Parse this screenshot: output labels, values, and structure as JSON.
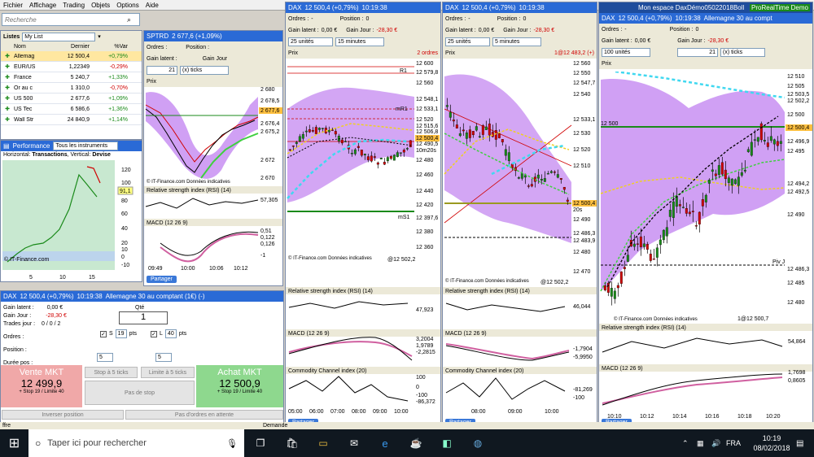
{
  "menu": [
    "Fichier",
    "Affichage",
    "Trading",
    "Objets",
    "Options",
    "Aide"
  ],
  "search": {
    "placeholder": "Recherche"
  },
  "lists": {
    "tab": "Listes",
    "selected": "My List",
    "cols": [
      "Nom",
      "Dernier",
      "%Var"
    ],
    "rows": [
      {
        "name": "Allemag",
        "price": "12 500,4",
        "var": "+0,79%",
        "pos": true
      },
      {
        "name": "EUR/US",
        "price": "1,22349",
        "var": "-0,29%",
        "pos": false
      },
      {
        "name": "France",
        "price": "5 240,7",
        "var": "+1,33%",
        "pos": true
      },
      {
        "name": "Or au c",
        "price": "1 310,0",
        "var": "-0,70%",
        "pos": false
      },
      {
        "name": "US 500",
        "price": "2 677,6",
        "var": "+1,09%",
        "pos": true
      },
      {
        "name": "US Tec",
        "price": "6 586,6",
        "var": "+1,36%",
        "pos": true
      },
      {
        "name": "Wall Str",
        "price": "24 840,9",
        "var": "+1,14%",
        "pos": true
      }
    ]
  },
  "performance": {
    "title": "Performance",
    "filter": "Tous les instruments",
    "subtitle_prefix": "Horizontal:",
    "subtitle_h": "Transactions",
    "subtitle_v_prefix": ", Vertical:",
    "subtitle_v": "Devise",
    "current": "91,1",
    "xticks": [
      "5",
      "10",
      "15"
    ],
    "yticks": [
      "120",
      "100",
      "80",
      "60",
      "40",
      "20",
      "10",
      "0",
      "-10"
    ],
    "credit": "© IT-Finance.com"
  },
  "order": {
    "instrument": "DAX",
    "header": "12 500,4 (+0,79%)",
    "time": "10:19:38",
    "desc": "Allemagne 30 au comptant (1€) (-)",
    "qty_label": "Qté",
    "qty": "1",
    "gain_latent_label": "Gain latent :",
    "gain_latent": "0,00 €",
    "gain_jour_label": "Gain Jour :",
    "gain_jour": "-28,30 €",
    "trades_label": "Trades jour :",
    "trades": "0 / 0 / 2",
    "ordres_label": "Ordres :",
    "position_label": "Position :",
    "duree_label": "Durée pos :",
    "s_label": "S",
    "s_val": "19",
    "l_label": "L",
    "l_val": "40",
    "pts": "pts",
    "step1": "5",
    "step2": "5",
    "sell_label": "Vente MKT",
    "sell_price": "12 499,9",
    "sell_stop": "+ Stop 19 / Limite 40",
    "buy_label": "Achat MKT",
    "buy_price": "12 500,9",
    "buy_stop": "+ Stop 19 / Limite 40",
    "stop5": "Stop à 5 ticks",
    "limit5": "Limite à 5 ticks",
    "no_stop": "Pas de stop",
    "reverse": "Inverser position",
    "no_orders": "Pas d'ordres en attente"
  },
  "spx": {
    "title": "SPTRD",
    "header": "2 677,6 (+1,09%)",
    "ticks_sel": "21",
    "ticks_label": "(x) ticks",
    "ordres_label": "Ordres :",
    "position_label": "Position :",
    "gain_latent_label": "Gain latent :",
    "gain_jour_label": "Gain Jour",
    "price_tab": "Prix",
    "last": "2 677,6",
    "levels": [
      "2 680",
      "2 678,5",
      "2 677,6",
      "2 676,4",
      "2 675,2",
      "2 672",
      "2 670"
    ],
    "xticks": [
      "09:49",
      "10:00",
      "10:06",
      "10:12"
    ],
    "rsi": "Relative strength index (RSI) (14)",
    "rsi_val": "57,305",
    "macd": "MACD (12 26 9)",
    "macd_vals": [
      "0,51",
      "0,122",
      "0,126",
      "-1"
    ],
    "credit": "© IT-Finance.com  Données indicatives",
    "share": "Partager"
  },
  "c1": {
    "title": "DAX",
    "header": "12 500,4 (+0,79%)",
    "time": "10:19:38",
    "ordres_label": "Ordres :",
    "ordres": "-",
    "position_label": "Position :",
    "position": "0",
    "gain_latent_label": "Gain latent :",
    "gain_latent": "0,00 €",
    "gain_jour_label": "Gain Jour :",
    "gain_jour": "-28,30 €",
    "units": "25 unités",
    "period": "15 minutes",
    "price_tab": "Prix",
    "orders_badge": "2 ordres",
    "levels": [
      "12 600",
      "12 579,8",
      "12 560",
      "12 548,1",
      "12 533,1",
      "12 520",
      "12 515,6",
      "12 506,8",
      "12 500,4",
      "12 490,5",
      "12 480",
      "12 460",
      "12 440",
      "12 420",
      "12 397,6",
      "12 380",
      "12 360"
    ],
    "timer": "10m20s",
    "pivot": "@12 502,2",
    "r_labels": [
      "R1",
      "mR1",
      "mS1"
    ],
    "xticks": [
      "05:00",
      "06:00",
      "07:00",
      "08:00",
      "09:00",
      "10:00"
    ],
    "rsi": "Relative strength index (RSI) (14)",
    "rsi_val": "47,923",
    "macd": "MACD (12 26 9)",
    "macd_vals": [
      "3,2004",
      "1,9789",
      "-2,2815"
    ],
    "cci": "Commodity Channel index (20)",
    "cci_vals": [
      "100",
      "0",
      "-100",
      "-86,372"
    ],
    "credit": "© IT-Finance.com  Données indicatives",
    "share": "Partager"
  },
  "c2": {
    "title": "DAX",
    "header": "12 500,4 (+0,79%)",
    "time": "10:19:38",
    "ordres_label": "Ordres :",
    "ordres": "-",
    "position_label": "Position :",
    "position": "0",
    "gain_latent_label": "Gain latent :",
    "gain_latent": "0,00 €",
    "gain_jour_label": "Gain Jour :",
    "gain_jour": "-28,30 €",
    "units": "25 unités",
    "period": "5 minutes",
    "price_tab": "Prix",
    "badge": "1@12 483,2 (+)",
    "levels": [
      "12 560",
      "12 550",
      "12 547,7",
      "12 540",
      "12 533,1",
      "12 530",
      "12 520",
      "12 510",
      "12 500,4",
      "12 490",
      "12 486,3",
      "12 483,9",
      "12 480",
      "12 470"
    ],
    "timer": "20s",
    "pivot": "@12 502,2",
    "xticks": [
      "08:00",
      "09:00",
      "10:00"
    ],
    "rsi": "Relative strength index (RSI) (14)",
    "rsi_val": "46,044",
    "macd": "MACD (12 26 9)",
    "macd_vals": [
      "-1,7904",
      "-5,9950"
    ],
    "cci": "Commodity Channel index (20)",
    "cci_vals": [
      "-81,269",
      "-100"
    ],
    "credit": "© IT-Finance.com  Données indicatives",
    "share": "Partager"
  },
  "c3": {
    "window_title": "Mon espace DaxDémo05022018Boll",
    "brand": "ProRealTime",
    "brand_mode": "Demo",
    "title": "DAX",
    "header": "12 500,4 (+0,79%)",
    "time": "10:19:38",
    "desc": "Allemagne 30 au compt",
    "ordres_label": "Ordres :",
    "ordres": "-",
    "position_label": "Position :",
    "position": "0",
    "gain_latent_label": "Gain latent :",
    "gain_latent": "0,00 €",
    "gain_jour_label": "Gain Jour :",
    "gain_jour": "-28,30 €",
    "units": "100 unités",
    "ticks_sel": "21",
    "ticks_label": "(x) ticks",
    "price_tab": "Prix",
    "levels": [
      "12 510",
      "12 505",
      "12 503,5",
      "12 502,2",
      "12 500",
      "12 500,4",
      "12 496,9",
      "12 495",
      "12 494,2",
      "12 492,5",
      "12 490",
      "12 486,3",
      "12 485",
      "12 480"
    ],
    "pivot_label": "Piv J",
    "pivot_val": "12 500",
    "badge": "1@12 500,7",
    "xticks": [
      "10:10",
      "10:12",
      "10:14",
      "10:16",
      "10:18",
      "10:20"
    ],
    "rsi": "Relative strength index (RSI) (14)",
    "rsi_val": "54,864",
    "macd": "MACD (12 26 9)",
    "macd_vals": [
      "1,7698",
      "0,8605"
    ],
    "credit": "© IT-Finance.com  Données indicatives",
    "share": "Partager"
  },
  "status": {
    "left": "ffre",
    "right": "Demande"
  },
  "taskbar": {
    "search_placeholder": "Taper ici pour rechercher",
    "time": "10:19",
    "date": "08/02/2018",
    "lang": "FRA"
  },
  "colors": {
    "band": "#c080f0",
    "up": "#1a8a1a",
    "down": "#d00000",
    "sell": "#f0a8a8",
    "buy": "#8ed88e",
    "accent": "#2a6ad6"
  }
}
